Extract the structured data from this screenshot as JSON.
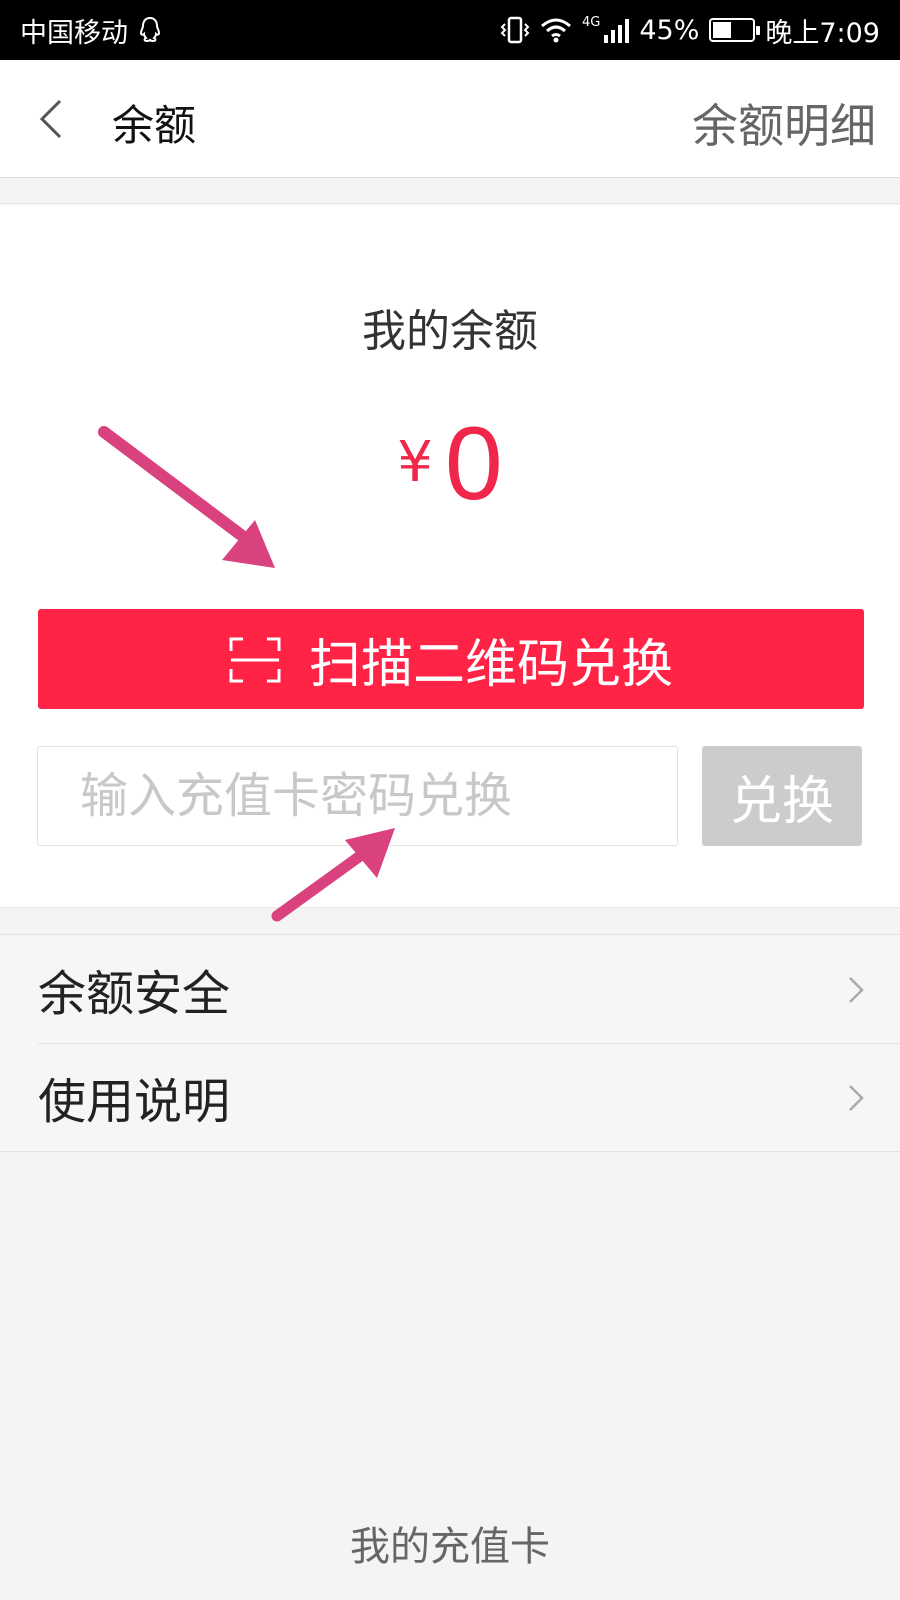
{
  "status_bar": {
    "carrier": "中国移动",
    "network": "4G",
    "battery": "45%",
    "time": "晚上7:09",
    "icons": [
      "qq-icon",
      "vibrate-icon",
      "wifi-icon",
      "signal-icon",
      "battery-icon"
    ]
  },
  "header": {
    "title": "余额",
    "detail_link": "余额明细"
  },
  "balance": {
    "label": "我的余额",
    "currency": "¥",
    "amount": "0"
  },
  "actions": {
    "scan_button": "扫描二维码兑换",
    "code_placeholder": "输入充值卡密码兑换",
    "redeem_button": "兑换"
  },
  "menu": {
    "items": [
      {
        "label": "余额安全"
      },
      {
        "label": "使用说明"
      }
    ]
  },
  "footer": {
    "card_link": "我的充值卡"
  },
  "colors": {
    "accent": "#ff2346",
    "amount": "#f0264a",
    "disabled_button": "#cccccc",
    "annotation_arrow": "#d9417f"
  }
}
